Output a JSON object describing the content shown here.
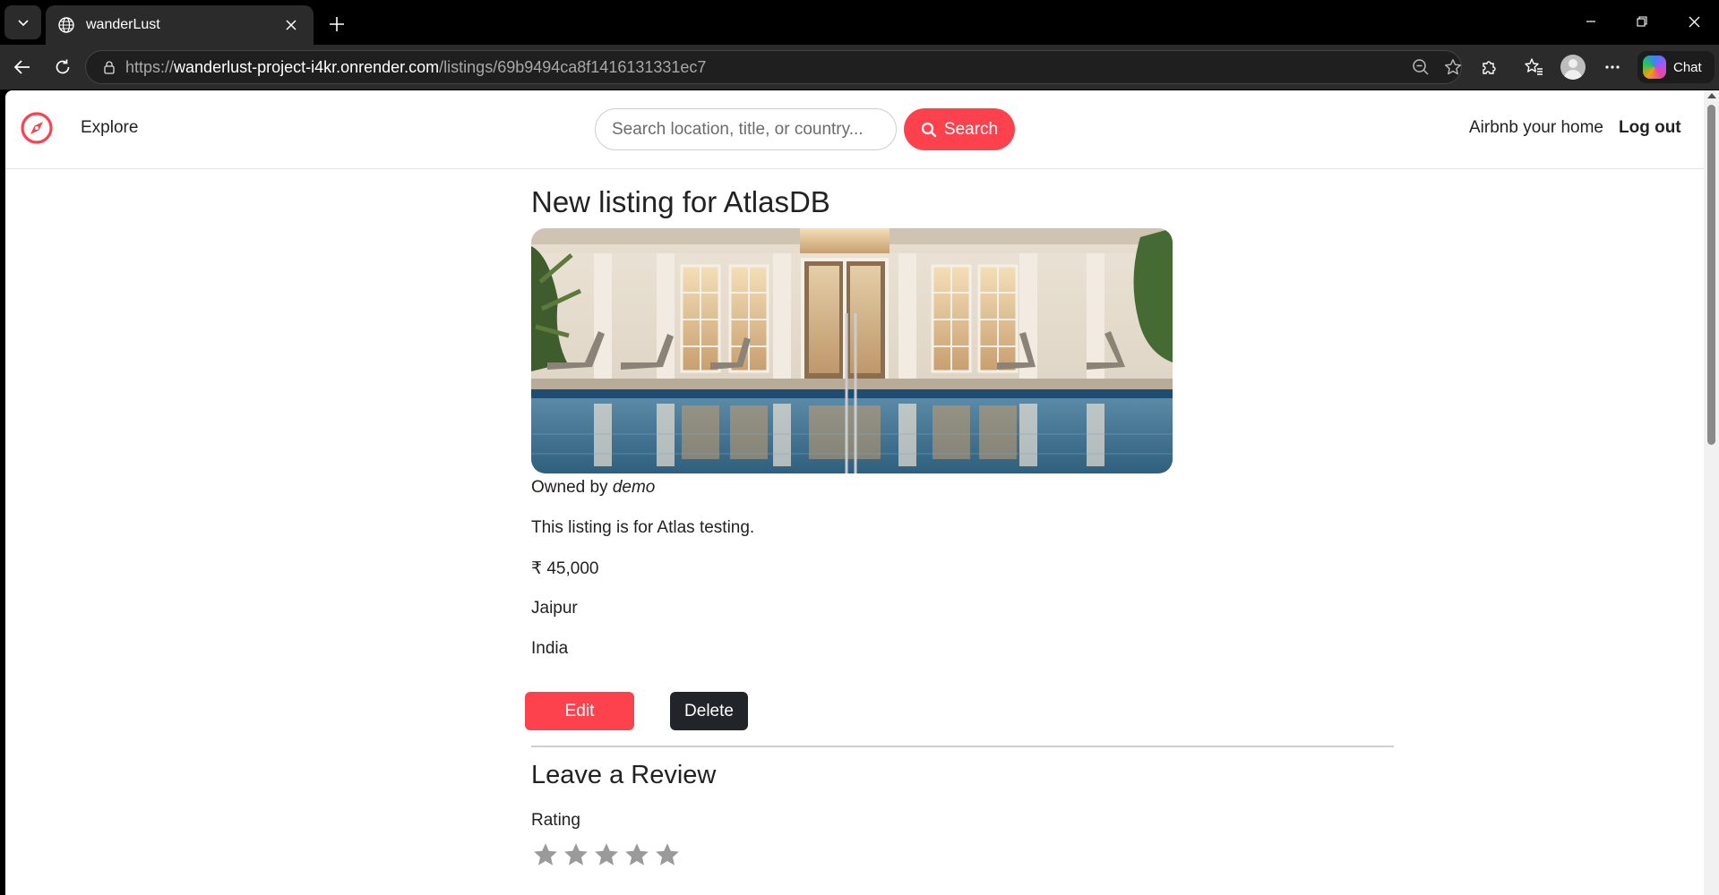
{
  "browser": {
    "tab_title": "wanderLust",
    "url_scheme": "https://",
    "url_host": "wanderlust-project-i4kr.onrender.com",
    "url_path": "/listings/69b9494ca8f1416131331ec7",
    "chat_label": "Chat"
  },
  "navbar": {
    "explore_label": "Explore",
    "search_placeholder": "Search location, title, or country...",
    "search_button_label": "Search",
    "host_label": "Airbnb your home",
    "logout_label": "Log out",
    "brand_color": "#fe424d"
  },
  "listing": {
    "title": "New listing for AtlasDB",
    "owner_prefix": "Owned by",
    "owner_name": "demo",
    "description": "This listing is for Atlas testing.",
    "price": "₹ 45,000",
    "location": "Jaipur",
    "country": "India",
    "edit_label": "Edit",
    "delete_label": "Delete"
  },
  "review": {
    "heading": "Leave a Review",
    "rating_label": "Rating",
    "stars_max": 5,
    "stars_selected": 0
  }
}
